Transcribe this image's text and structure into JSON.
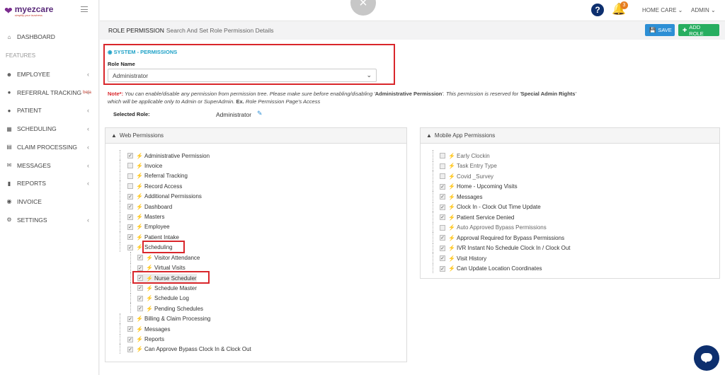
{
  "brand": {
    "name": "myezcare",
    "tagline": "simplify your business"
  },
  "sidebar": {
    "dashboard": "DASHBOARD",
    "section_label": "FEATURES",
    "items": [
      {
        "label": "EMPLOYEE",
        "icon": "users-icon",
        "chevron": true
      },
      {
        "label": "REFERRAL TRACKING",
        "icon": "user-icon",
        "chevron": true,
        "badge": "beta"
      },
      {
        "label": "PATIENT",
        "icon": "user-icon",
        "chevron": true
      },
      {
        "label": "SCHEDULING",
        "icon": "calendar-icon",
        "chevron": true
      },
      {
        "label": "CLAIM PROCESSING",
        "icon": "file-icon",
        "chevron": true
      },
      {
        "label": "MESSAGES",
        "icon": "envelope-icon",
        "chevron": true
      },
      {
        "label": "REPORTS",
        "icon": "bar-chart-icon",
        "chevron": true
      },
      {
        "label": "INVOICE",
        "icon": "money-icon",
        "chevron": false
      },
      {
        "label": "SETTINGS",
        "icon": "gear-icon",
        "chevron": true
      }
    ]
  },
  "topbar": {
    "notification_count": "3",
    "home_care": "HOME CARE",
    "admin": "ADMIN"
  },
  "header": {
    "title": "ROLE PERMISSION",
    "subtitle": "Search And Set Role Permission Details",
    "save_label": "SAVE",
    "add_role_label": "ADD ROLE"
  },
  "system": {
    "title": "SYSTEM - PERMISSIONS",
    "role_label": "Role Name",
    "role_value": "Administrator"
  },
  "note": {
    "label": "Note*:",
    "text1": " You can enable/disable any permission from permission tree. Please make sure before enabling/disabling '",
    "bold1": "Administrative Permission",
    "text2": "'. This permission is reserved for '",
    "bold2": "Special Admin Rights",
    "text3": "'",
    "line2a": "which will be applicable only to Admin or SuperAdmin. ",
    "bold3": "Ex.",
    "line2b": " Role Permission Page's Access"
  },
  "selected_role": {
    "label": "Selected Role:",
    "value": "Administrator"
  },
  "web_permissions": {
    "title": "Web Permissions",
    "items": [
      {
        "label": "Administrative Permission",
        "checked": true,
        "level": 0
      },
      {
        "label": "Invoice",
        "checked": false,
        "level": 0
      },
      {
        "label": "Referral Tracking",
        "checked": false,
        "level": 0
      },
      {
        "label": "Record Access",
        "checked": false,
        "level": 0
      },
      {
        "label": "Additional Permissions",
        "checked": true,
        "level": 0
      },
      {
        "label": "Dashboard",
        "checked": true,
        "level": 0
      },
      {
        "label": "Masters",
        "checked": true,
        "level": 0
      },
      {
        "label": "Employee",
        "checked": true,
        "level": 0
      },
      {
        "label": "Patient Intake",
        "checked": true,
        "level": 0
      },
      {
        "label": "Scheduling",
        "checked": true,
        "level": 0,
        "highlight": true
      },
      {
        "label": "Visitor Attendance",
        "checked": true,
        "level": 1
      },
      {
        "label": "Virtual Visits",
        "checked": true,
        "level": 1
      },
      {
        "label": "Nurse Scheduler",
        "checked": true,
        "level": 1,
        "highlight": true
      },
      {
        "label": "Schedule Master",
        "checked": true,
        "level": 1
      },
      {
        "label": "Schedule Log",
        "checked": true,
        "level": 1
      },
      {
        "label": "Pending Schedules",
        "checked": true,
        "level": 1
      },
      {
        "label": "Billing & Claim Processing",
        "checked": true,
        "level": 0
      },
      {
        "label": "Messages",
        "checked": true,
        "level": 0
      },
      {
        "label": "Reports",
        "checked": true,
        "level": 0
      },
      {
        "label": "Can Approve Bypass Clock In & Clock Out",
        "checked": true,
        "level": 0
      }
    ]
  },
  "mobile_permissions": {
    "title": "Mobile App Permissions",
    "items": [
      {
        "label": "Early Clockin",
        "checked": false
      },
      {
        "label": "Task Entry Type",
        "checked": false
      },
      {
        "label": "Covid _Survey",
        "checked": false
      },
      {
        "label": "Home - Upcoming Visits",
        "checked": true
      },
      {
        "label": "Messages",
        "checked": true
      },
      {
        "label": "Clock In - Clock Out Time Update",
        "checked": true
      },
      {
        "label": "Patient Service Denied",
        "checked": true
      },
      {
        "label": "Auto Approved Bypass Permissions",
        "checked": false
      },
      {
        "label": "Approval Required for Bypass Permissions",
        "checked": true
      },
      {
        "label": "IVR Instant No Schedule Clock In / Clock Out",
        "checked": true
      },
      {
        "label": "Visit History",
        "checked": true
      },
      {
        "label": "Can Update Location Coordinates",
        "checked": true
      }
    ]
  }
}
